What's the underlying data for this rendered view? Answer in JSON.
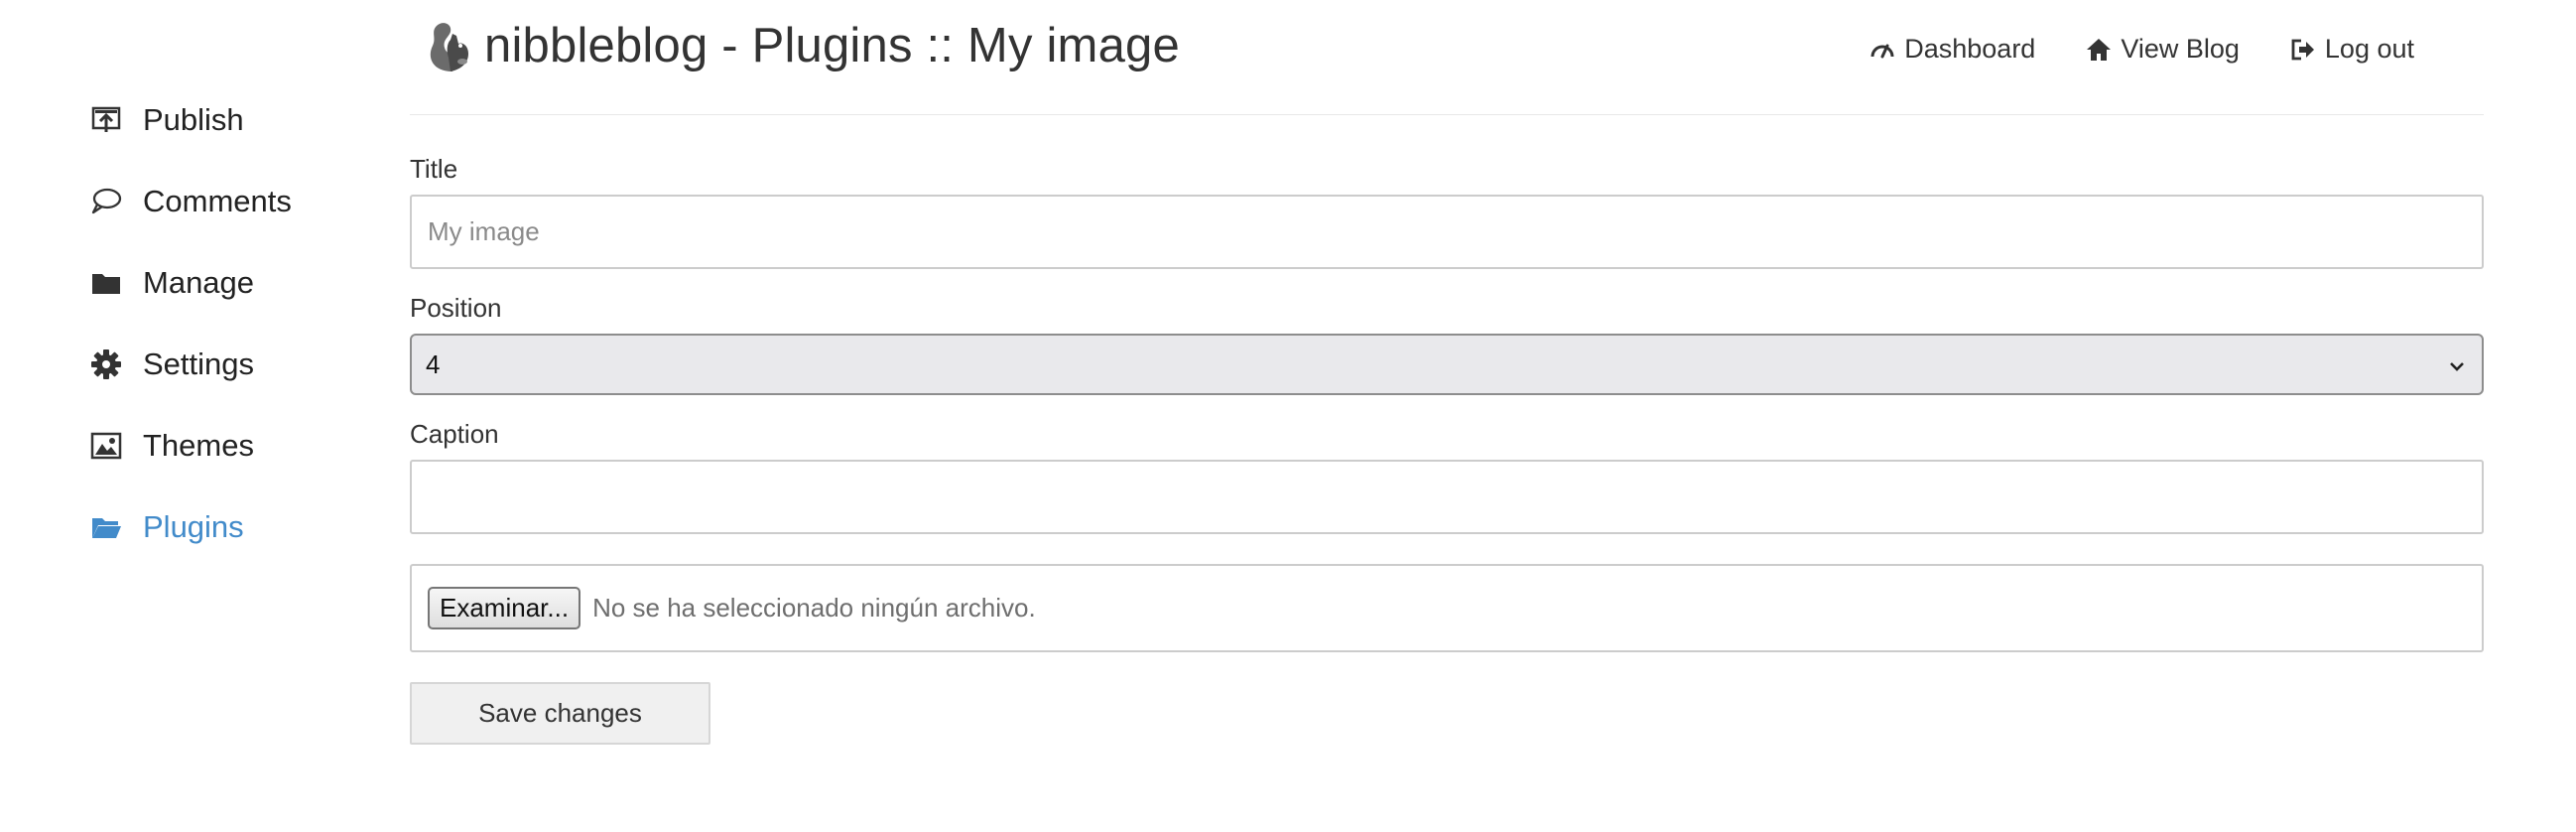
{
  "header": {
    "title": "nibbleblog - Plugins :: My image",
    "nav": [
      {
        "label": "Dashboard",
        "icon": "dashboard-icon"
      },
      {
        "label": "View Blog",
        "icon": "home-icon"
      },
      {
        "label": "Log out",
        "icon": "logout-icon"
      }
    ]
  },
  "sidebar": {
    "items": [
      {
        "label": "Publish",
        "icon": "publish-icon",
        "active": false
      },
      {
        "label": "Comments",
        "icon": "comment-icon",
        "active": false
      },
      {
        "label": "Manage",
        "icon": "folder-icon",
        "active": false
      },
      {
        "label": "Settings",
        "icon": "gear-icon",
        "active": false
      },
      {
        "label": "Themes",
        "icon": "image-icon",
        "active": false
      },
      {
        "label": "Plugins",
        "icon": "folder-open-icon",
        "active": true
      }
    ],
    "active_color": "#428bca"
  },
  "form": {
    "title_label": "Title",
    "title_placeholder": "My image",
    "title_value": "",
    "position_label": "Position",
    "position_value": "4",
    "caption_label": "Caption",
    "caption_value": "",
    "file_button_label": "Examinar...",
    "file_status": "No se ha seleccionado ningún archivo.",
    "save_label": "Save changes"
  }
}
